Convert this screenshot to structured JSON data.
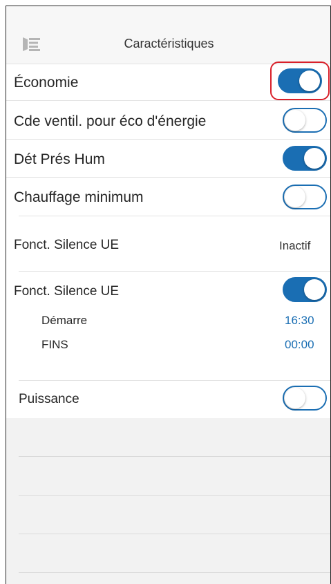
{
  "header": {
    "title": "Caractéristiques",
    "menu_icon": "menu-icon"
  },
  "settings": {
    "economie": {
      "label": "Économie",
      "on": true
    },
    "cde_ventil": {
      "label": "Cde ventil. pour éco d'énergie",
      "on": false
    },
    "det_pres_hum": {
      "label": "Dét Prés Hum",
      "on": true
    },
    "chauffage_min": {
      "label": "Chauffage minimum",
      "on": false
    },
    "silence_status": {
      "label": "Fonct. Silence UE",
      "value": "Inactif"
    },
    "silence_toggle": {
      "label": "Fonct. Silence UE",
      "on": true,
      "start_label": "Démarre",
      "start_value": "16:30",
      "end_label": "FINS",
      "end_value": "00:00"
    },
    "puissance": {
      "label": "Puissance",
      "on": false
    }
  },
  "colors": {
    "accent": "#1a6eb3",
    "highlight": "#d9202a",
    "header_bg": "#f7f7f7"
  }
}
